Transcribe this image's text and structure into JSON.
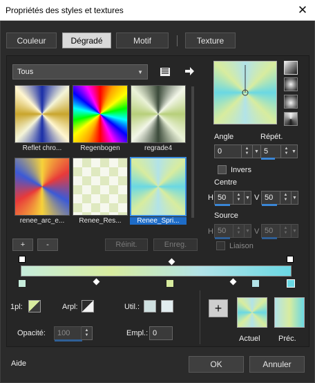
{
  "window": {
    "title": "Propriétés des styles et textures",
    "close_glyph": "✕"
  },
  "tabs": [
    {
      "label": "Couleur"
    },
    {
      "label": "Dégradé",
      "active": true
    },
    {
      "label": "Motif"
    },
    {
      "label": "Texture"
    }
  ],
  "library": {
    "category": "Tous",
    "items": [
      {
        "label": "Reflet chro..."
      },
      {
        "label": "Regenbogen"
      },
      {
        "label": "regrade4"
      },
      {
        "label": "renee_arc_e..."
      },
      {
        "label": "Renee_Res..."
      },
      {
        "label": "Renee_Spri...",
        "selected": true
      }
    ]
  },
  "buttons": {
    "add": "+",
    "remove": "-",
    "reset": "Réinit.",
    "save": "Enreg."
  },
  "params": {
    "angle_label": "Angle",
    "angle_value": "0",
    "repeat_label": "Répét.",
    "repeat_value": "5",
    "invert_label": "Invers",
    "center_label": "Centre",
    "center_h_label": "H",
    "center_h": "50",
    "center_v_label": "V",
    "center_v": "50",
    "source_label": "Source",
    "source_h_label": "H",
    "source_h": "50",
    "source_v_label": "V",
    "source_v": "50",
    "link_label": "Liaison"
  },
  "gradient": {
    "colors": [
      "#c6ecdb",
      "#d8ec9f",
      "#b2e3e8",
      "#6ad8e3"
    ]
  },
  "bottom": {
    "fg_label": "1pl:",
    "bg_label": "Arpl:",
    "user_label": "Util.:",
    "opacity_label": "Opacité:",
    "opacity_value": "100",
    "position_label": "Empl.:",
    "position_value": "0",
    "add_glyph": "+",
    "current_label": "Actuel",
    "previous_label": "Préc."
  },
  "footer": {
    "help": "Aide",
    "ok": "OK",
    "cancel": "Annuler"
  },
  "icons": {
    "list": "list-view-icon",
    "arrow": "arrow-right-icon"
  }
}
